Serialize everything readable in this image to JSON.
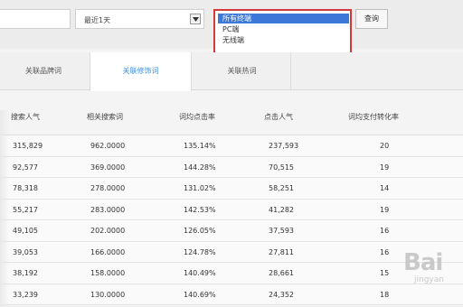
{
  "filters": {
    "date_range": "最近1天",
    "terminal_options": [
      "所有终端",
      "PC端",
      "无线端"
    ],
    "selected_terminal": "所有终端",
    "query_label": "查询"
  },
  "tabs": [
    {
      "label": "关联品牌词",
      "active": false
    },
    {
      "label": "关联修饰词",
      "active": true
    },
    {
      "label": "关联热词",
      "active": false
    }
  ],
  "table": {
    "headers": [
      "搜索人气",
      "相关搜索词",
      "词均点击率",
      "点击人气",
      "词均支付转化率"
    ],
    "rows": [
      [
        "315,829",
        "962.0000",
        "135.14%",
        "237,593",
        "20"
      ],
      [
        "92,577",
        "369.0000",
        "144.28%",
        "70,515",
        "19"
      ],
      [
        "78,318",
        "278.0000",
        "131.02%",
        "58,251",
        "14"
      ],
      [
        "55,217",
        "283.0000",
        "142.53%",
        "41,282",
        "19"
      ],
      [
        "49,105",
        "202.0000",
        "126.05%",
        "37,593",
        "16"
      ],
      [
        "39,053",
        "166.0000",
        "124.78%",
        "27,811",
        "16"
      ],
      [
        "38,192",
        "158.0000",
        "140.49%",
        "28,661",
        "15"
      ],
      [
        "33,239",
        "130.0000",
        "140.69%",
        "24,352",
        "18"
      ]
    ]
  },
  "watermark": {
    "text": "Bai",
    "sub": "jingyan"
  },
  "colors": {
    "accent": "#3d78d8",
    "highlight_border": "#d23a3a",
    "active_tab_text": "#3d8fe0"
  }
}
